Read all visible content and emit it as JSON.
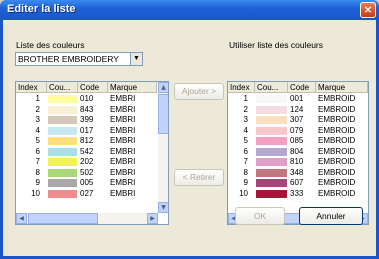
{
  "window": {
    "title": "Editer la liste"
  },
  "left": {
    "label": "Liste des couleurs",
    "dropdown_value": "BROTHER EMBROIDERY",
    "columns": [
      "Index",
      "Cou...",
      "Code",
      "Marque"
    ],
    "rows": [
      {
        "index": "1",
        "color": "#ffffa0",
        "code": "010",
        "brand": "EMBRI"
      },
      {
        "index": "2",
        "color": "#f8f0d4",
        "code": "843",
        "brand": "EMBRI"
      },
      {
        "index": "3",
        "color": "#d4c8b8",
        "code": "399",
        "brand": "EMBRI"
      },
      {
        "index": "4",
        "color": "#c8e8f0",
        "code": "017",
        "brand": "EMBRI"
      },
      {
        "index": "5",
        "color": "#ffe080",
        "code": "812",
        "brand": "EMBRI"
      },
      {
        "index": "6",
        "color": "#a8e0e8",
        "code": "542",
        "brand": "EMBRI"
      },
      {
        "index": "7",
        "color": "#f0f060",
        "code": "202",
        "brand": "EMBRI"
      },
      {
        "index": "8",
        "color": "#a8d878",
        "code": "502",
        "brand": "EMBRI"
      },
      {
        "index": "9",
        "color": "#a8a8a8",
        "code": "005",
        "brand": "EMBRI"
      },
      {
        "index": "10",
        "color": "#f08c8c",
        "code": "027",
        "brand": "EMBRI"
      }
    ]
  },
  "right": {
    "label": "Utiliser liste des couleurs",
    "columns": [
      "Index",
      "Cou...",
      "Code",
      "Marque"
    ],
    "rows": [
      {
        "index": "1",
        "color": "#f8f8f8",
        "code": "001",
        "brand": "EMBROID"
      },
      {
        "index": "2",
        "color": "#f4dce4",
        "code": "124",
        "brand": "EMBROID"
      },
      {
        "index": "3",
        "color": "#f8e0c0",
        "code": "307",
        "brand": "EMBROID"
      },
      {
        "index": "4",
        "color": "#f8c8cc",
        "code": "079",
        "brand": "EMBROID"
      },
      {
        "index": "5",
        "color": "#f4a0c0",
        "code": "085",
        "brand": "EMBROID"
      },
      {
        "index": "6",
        "color": "#b4a8d0",
        "code": "804",
        "brand": "EMBROID"
      },
      {
        "index": "7",
        "color": "#e0a0c8",
        "code": "810",
        "brand": "EMBROID"
      },
      {
        "index": "8",
        "color": "#c07880",
        "code": "348",
        "brand": "EMBROID"
      },
      {
        "index": "9",
        "color": "#a04878",
        "code": "607",
        "brand": "EMBROID"
      },
      {
        "index": "10",
        "color": "#a01838",
        "code": "333",
        "brand": "EMBROID"
      }
    ]
  },
  "buttons": {
    "add": "Ajouter >",
    "remove": "< Retirer",
    "ok": "OK",
    "cancel": "Annuler"
  },
  "icons": {
    "close": "×",
    "dropdown": "▼",
    "up": "▲",
    "down": "▼",
    "left": "◀",
    "right": "▶"
  }
}
